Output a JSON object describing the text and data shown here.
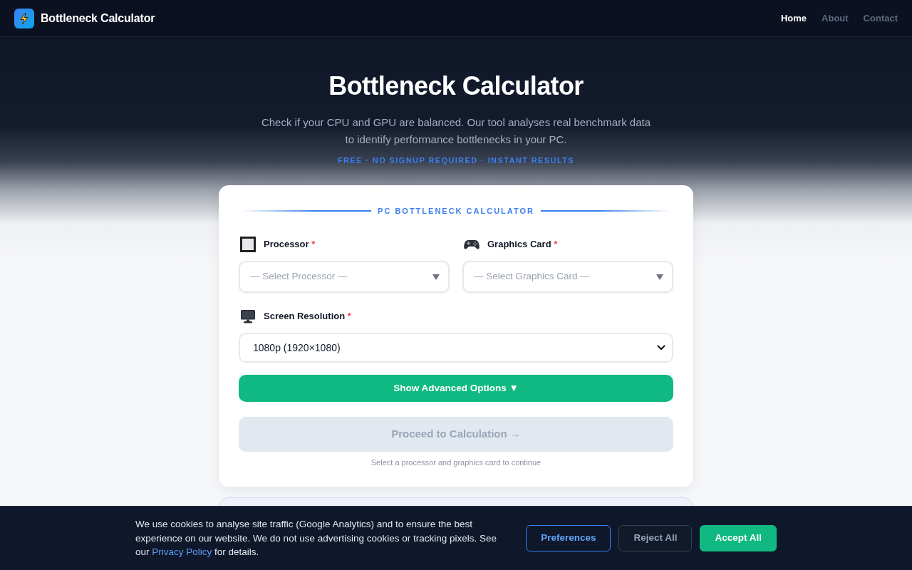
{
  "navbar": {
    "brand": "Bottleneck Calculator",
    "links": [
      {
        "label": "Home",
        "selected": true
      },
      {
        "label": "About",
        "selected": false
      },
      {
        "label": "Contact",
        "selected": false
      }
    ]
  },
  "hero": {
    "title": "Bottleneck Calculator",
    "subtitle": "Check if your CPU and GPU are balanced. Our tool analyses real benchmark data to identify performance bottlenecks in your PC.",
    "tagline": "FREE · NO SIGNUP REQUIRED · INSTANT RESULTS"
  },
  "calculator": {
    "heading": "PC BOTTLENECK CALCULATOR",
    "pickers": [
      {
        "kind": "processor",
        "label": "Processor",
        "required_mark": "*",
        "placeholder": "— Select Processor —"
      },
      {
        "kind": "graphics",
        "label": "Graphics Card",
        "required_mark": "*",
        "placeholder": "— Select Graphics Card —"
      }
    ],
    "resolution": {
      "label": "Screen Resolution",
      "required_mark": "*",
      "value": "1080p (1920×1080)"
    },
    "advanced_button": {
      "label": "Show Advanced Options ▼"
    },
    "proceed_button": {
      "label": "Proceed to Calculation →",
      "disabled": true
    },
    "hint": "Select a processor and graphics card to continue"
  },
  "cookie_banner": {
    "text_before": "We use cookies to analyse site traffic (Google Analytics) and to ensure the best experience on our website. We do not use advertising cookies or tracking pixels. See our",
    "link": "Privacy Policy",
    "text_after": "for details.",
    "buttons": [
      {
        "kind": "outline",
        "label": "Preferences"
      },
      {
        "kind": "dark",
        "label": "Reject All"
      },
      {
        "kind": "accept",
        "label": "Accept All"
      }
    ]
  }
}
